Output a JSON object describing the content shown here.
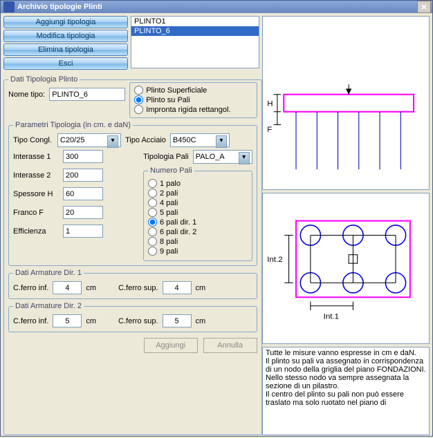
{
  "title": "Archivio tipologie Plinti",
  "buttons": {
    "add_type": "Aggiungi tipologia",
    "modify_type": "Modifica tipologia",
    "delete_type": "Elimina tipologia",
    "exit": "Esci",
    "add": "Aggiungi",
    "cancel": "Annulla"
  },
  "list": {
    "items": [
      "PLINTO1",
      "PLINTO_6"
    ],
    "selected_index": 1
  },
  "groups": {
    "dati_tipologia": "Dati Tipologia Plinto",
    "parametri": "Parametri Tipologia  (in cm.  e  daN)",
    "numero_pali": "Numero Pali",
    "arm1": "Dati Armature Dir. 1",
    "arm2": "Dati Armature Dir. 2"
  },
  "labels": {
    "nome_tipo": "Nome tipo:",
    "tipo_congl": "Tipo Congl.",
    "tipo_acciaio": "Tipo Acciaio",
    "tipologia_pali": "Tipologia Pali",
    "interasse1": "Interasse 1",
    "interasse2": "Interasse 2",
    "spessore": "Spessore H",
    "franco": "Franco F",
    "efficienza": "Efficienza",
    "cferro_inf": "C.ferro inf.",
    "cferro_sup": "C.ferro sup.",
    "cm": "cm"
  },
  "values": {
    "nome_tipo": "PLINTO_6",
    "tipo_congl": "C20/25",
    "tipo_acciaio": "B450C",
    "tipologia_pali": "PALO_A",
    "interasse1": "300",
    "interasse2": "200",
    "spessore": "60",
    "franco": "20",
    "efficienza": "1",
    "arm1_inf": "4",
    "arm1_sup": "4",
    "arm2_inf": "5",
    "arm2_sup": "5"
  },
  "plinto_type": {
    "options": [
      "Plinto Superficiale",
      "Plinto su Pali",
      "Impronta rigida rettangol."
    ],
    "selected": 1
  },
  "numero_pali": {
    "options": [
      "1 palo",
      "2 pali",
      "4 pali",
      "5 pali",
      "6 pali dir. 1",
      "6 pali dir. 2",
      "8 pali",
      "9 pali"
    ],
    "selected": 4
  },
  "diagram": {
    "h_label": "H",
    "f_label": "F",
    "int1": "Int.1",
    "int2": "Int.2"
  },
  "help_text": "Tutte le misure vanno espresse in cm e daN.\nIl plinto su pali va assegnato in corrispondenza di un nodo della griglia del piano FONDAZIONI. Nello stesso nodo va sempre assegnata la sezione di un pilastro.\nIl centro del plinto su pali non può essere traslato ma solo ruotato nel piano di"
}
